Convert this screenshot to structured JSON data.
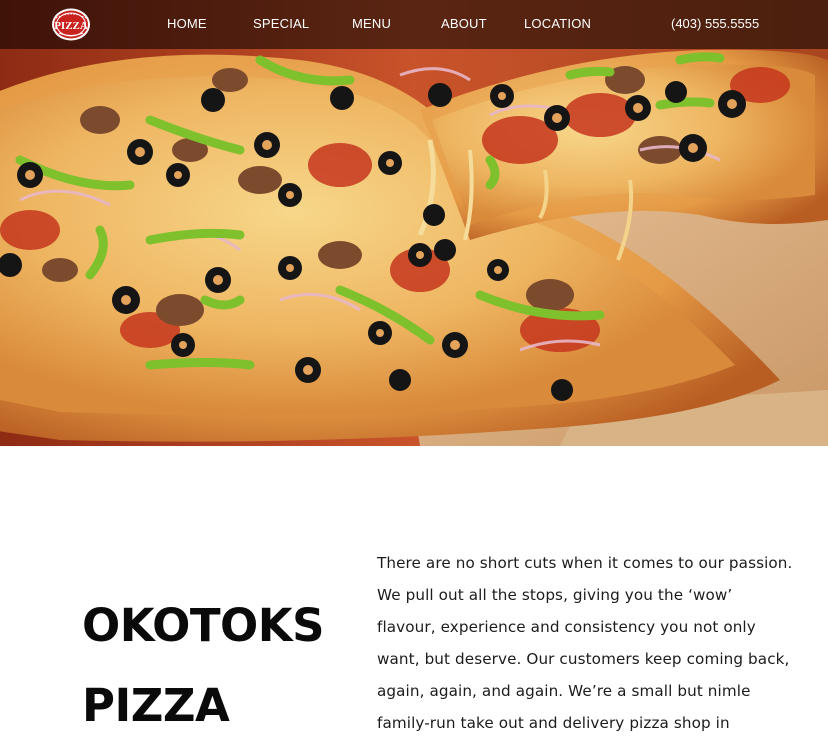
{
  "header": {
    "logo_text": "PIZZA",
    "nav": {
      "home": "HOME",
      "special": "SPECIAL",
      "menu": "MENU",
      "about": "ABOUT",
      "location": "LOCATION"
    },
    "phone": "(403) 555.5555"
  },
  "hero": {
    "image": "pizza-photo"
  },
  "about": {
    "title_line1": "OKOTOKS",
    "title_line2": "PIZZA",
    "paragraph": "There are no short cuts when it comes to our passion. We pull out all the stops, giving you the ‘wow’ flavour, experience and consistency you not only want, but deserve. Our customers keep coming back, again, again, and again. We’re a small but nimle family-run take out and delivery pizza shop in"
  },
  "colors": {
    "nav_overlay": "#000000",
    "nav_text": "#ffffff",
    "heading": "#0a0a0a",
    "body_text": "#1c1c1c",
    "logo_red": "#c8231e"
  }
}
